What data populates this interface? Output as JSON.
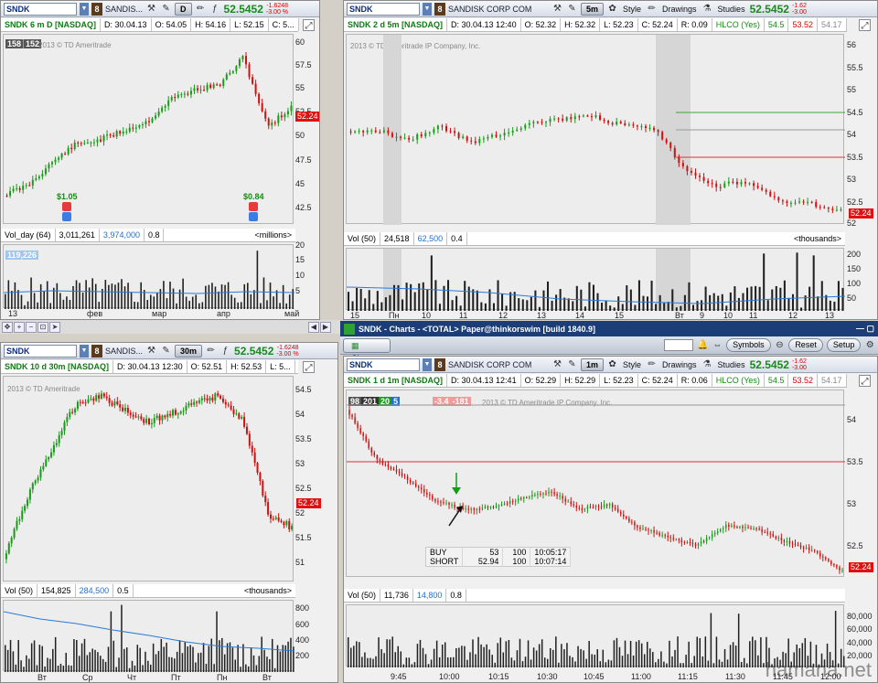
{
  "panels": {
    "tl": {
      "symbol": "SNDK",
      "link_num": "8",
      "desc": "SANDIS...",
      "agg": "D",
      "last": "52.5452",
      "chg1": "-1.6248",
      "chg2": "-3.00 %",
      "title": "SNDK 6 m D [NASDAQ]",
      "date": "D: 30.04.13",
      "open": "O: 54.05",
      "high": "H: 54.16",
      "low": "L: 52.15",
      "close": "C: 5...",
      "badges": [
        "158",
        "152"
      ],
      "watermark": "2013 © TD Ameritrade",
      "y_ticks": [
        "60",
        "57.5",
        "55",
        "52.5",
        "50",
        "47.5",
        "45",
        "42.5"
      ],
      "price_tag": "52.24",
      "div1": "$1.05",
      "div2": "$0.84",
      "vol_label": "Vol_day (64)",
      "vol_val": "3,011,261",
      "vol_avg": "3,974,000",
      "vol_scale": "0.8",
      "vol_units": "<millions>",
      "vol_y": [
        "20",
        "15",
        "10",
        "5"
      ],
      "vol_flag": "119,226",
      "x_ticks": [
        "13",
        "фев",
        "мар",
        "апр",
        "май"
      ]
    },
    "tr": {
      "symbol": "SNDK",
      "link_num": "8",
      "desc": "SANDISK CORP COM",
      "agg": "5m",
      "style": "Style",
      "drawings": "Drawings",
      "studies": "Studies",
      "last": "52.5452",
      "chg1": "-1.62",
      "chg2": "-3.00",
      "title": "SNDK 2 d 5m [NASDAQ]",
      "date": "D: 30.04.13 12:40",
      "open": "O: 52.32",
      "high": "H: 52.32",
      "low": "L: 52.23",
      "close": "C: 52.24",
      "range": "R: 0.09",
      "hlco": "HLCO (Yes)",
      "h1": "54.5",
      "h2": "53.52",
      "h3": "54.17",
      "watermark": "2013 © TD Ameritrade IP Company, Inc.",
      "y_ticks": [
        "56",
        "55.5",
        "55",
        "54.5",
        "54",
        "53.5",
        "53",
        "52.5",
        "52"
      ],
      "price_tag": "52.24",
      "vol_label": "Vol (50)",
      "vol_val": "24,518",
      "vol_avg": "62,500",
      "vol_scale": "0.4",
      "vol_units": "<thousands>",
      "vol_y": [
        "200",
        "150",
        "100",
        "50"
      ],
      "x_ticks": [
        "15",
        "Пн",
        "10",
        "11",
        "12",
        "13",
        "14",
        "15",
        "Вт",
        "9",
        "10",
        "11",
        "12",
        "13"
      ]
    },
    "bl": {
      "symbol": "SNDK",
      "link_num": "8",
      "desc": "SANDIS...",
      "agg": "30m",
      "last": "52.5452",
      "chg1": "-1.6248",
      "chg2": "-3.00 %",
      "title": "SNDK 10 d 30m [NASDAQ]",
      "date": "D: 30.04.13 12:30",
      "open": "O: 52.51",
      "high": "H: 52.53",
      "low": "L: 5...",
      "watermark": "2013 © TD Ameritrade",
      "y_ticks": [
        "54.5",
        "54",
        "53.5",
        "53",
        "52.5",
        "52",
        "51.5",
        "51"
      ],
      "price_tag": "52.24",
      "vol_label": "Vol (50)",
      "vol_val": "154,825",
      "vol_avg": "284,500",
      "vol_scale": "0.5",
      "vol_units": "<thousands>",
      "vol_y": [
        "800",
        "600",
        "400",
        "200"
      ],
      "x_ticks": [
        "Вт",
        "Ср",
        "Чт",
        "Пт",
        "Пн",
        "Вт"
      ]
    },
    "br": {
      "symbol": "SNDK",
      "link_num": "8",
      "desc": "SANDISK CORP COM",
      "agg": "1m",
      "style": "Style",
      "drawings": "Drawings",
      "studies": "Studies",
      "last": "52.5452",
      "chg1": "-1.62",
      "chg2": "-3.00",
      "title": "SNDK 1 d 1m [NASDAQ]",
      "date": "D: 30.04.13 12:41",
      "open": "O: 52.29",
      "high": "H: 52.29",
      "low": "L: 52.23",
      "close": "C: 52.24",
      "range": "R: 0.06",
      "hlco": "HLCO (Yes)",
      "h1": "54.5",
      "h2": "53.52",
      "h3": "54.17",
      "studies_badges": [
        "98",
        "201",
        "20",
        "5"
      ],
      "pl_badges": [
        "-3.4",
        "-181"
      ],
      "watermark": "2013 © TD Ameritrade IP Company, Inc.",
      "y_ticks": [
        "54",
        "53.5",
        "53",
        "52.5"
      ],
      "price_tag": "52.24",
      "orders": [
        {
          "side": "BUY",
          "price": "53",
          "qty": "100",
          "time": "10:05:17"
        },
        {
          "side": "SHORT",
          "price": "52.94",
          "qty": "100",
          "time": "10:07:14"
        }
      ],
      "vol_label": "Vol (50)",
      "vol_val": "11,736",
      "vol_avg": "14,800",
      "vol_scale": "0.8",
      "vol_y": [
        "80,000",
        "60,000",
        "40,000",
        "20,000"
      ],
      "x_ticks": [
        "9:45",
        "10:00",
        "10:15",
        "10:30",
        "10:45",
        "11:00",
        "11:15",
        "11:30",
        "11:45",
        "12:00"
      ]
    }
  },
  "main_window": {
    "title": "SNDK - Charts - <TOTAL> Paper@thinkorswim [build 1840.9]",
    "tab": "Charts",
    "symbols": "Symbols",
    "reset": "Reset",
    "setup": "Setup"
  },
  "site_watermark": "hamana.net",
  "colors": {
    "up": "#1a9a1a",
    "down": "#d01010",
    "vol": "#202020",
    "ma": "#2c7ad6",
    "bg_plot": "#ededed"
  }
}
